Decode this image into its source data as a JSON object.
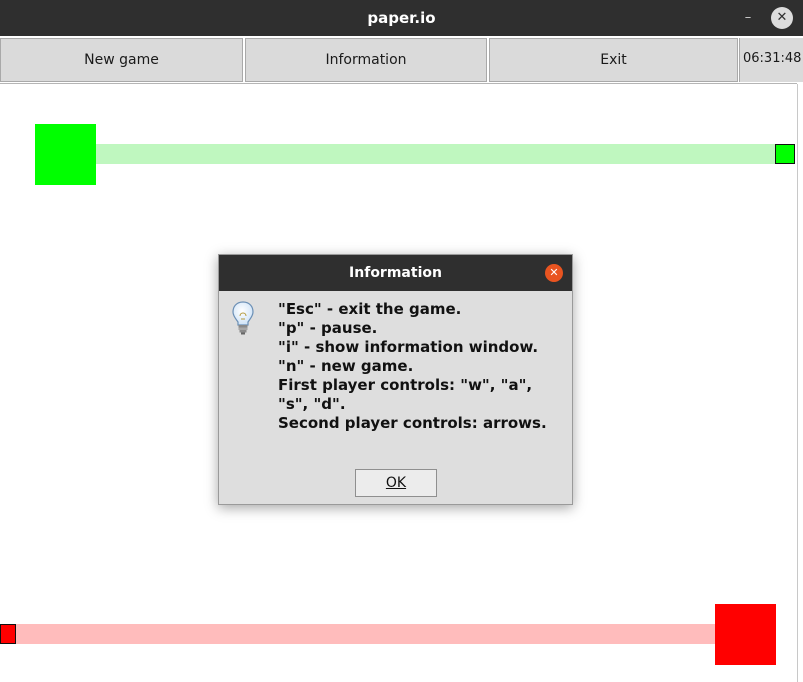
{
  "window": {
    "title": "paper.io",
    "minimize_glyph": "–",
    "close_glyph": "✕"
  },
  "toolbar": {
    "new_game_label": "New game",
    "information_label": "Information",
    "exit_label": "Exit",
    "clock": "06:31:48"
  },
  "board": {
    "player1_color": "#00ff00",
    "player1_trail_color": "#bff7bf",
    "player2_color": "#ff0000",
    "player2_trail_color": "#ffbcbc"
  },
  "dialog": {
    "title": "Information",
    "close_glyph": "✕",
    "lines": [
      "\"Esc\" - exit the game.",
      "\"p\" - pause.",
      "\"i\" - show information window.",
      "\"n\" - new game.",
      "First player controls: \"w\", \"a\",",
      "\"s\", \"d\".",
      "Second player controls: arrows."
    ],
    "ok_label": "OK"
  }
}
